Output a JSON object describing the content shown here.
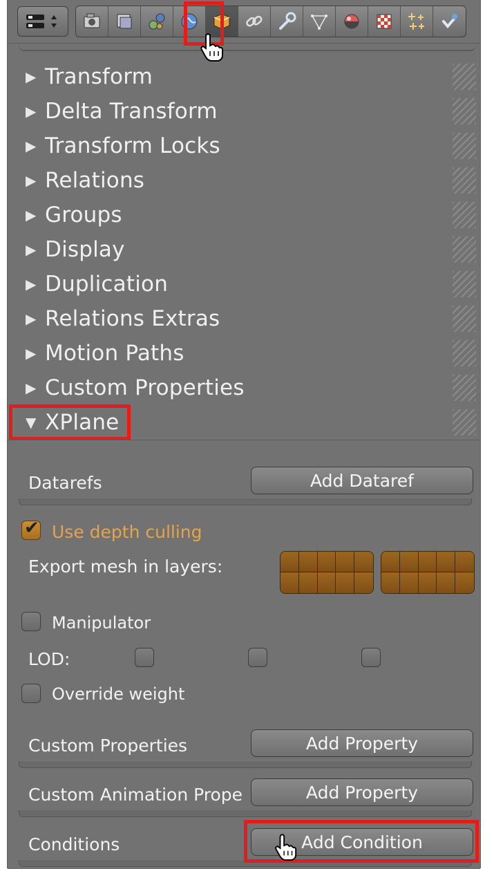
{
  "toolbar": {
    "context_icon": "editor-type-menu-icon",
    "tabs": [
      {
        "icon": "render-icon",
        "active": false
      },
      {
        "icon": "render-layers-icon",
        "active": false
      },
      {
        "icon": "scene-icon",
        "active": false
      },
      {
        "icon": "world-icon",
        "active": false
      },
      {
        "icon": "object-icon",
        "active": true
      },
      {
        "icon": "constraints-icon",
        "active": false
      },
      {
        "icon": "modifiers-icon",
        "active": false
      },
      {
        "icon": "object-data-icon",
        "active": false
      },
      {
        "icon": "material-icon",
        "active": false
      },
      {
        "icon": "texture-icon",
        "active": false
      },
      {
        "icon": "particles-icon",
        "active": false
      },
      {
        "icon": "physics-icon",
        "active": false
      }
    ]
  },
  "panels": [
    {
      "label": "Transform",
      "expanded": false
    },
    {
      "label": "Delta Transform",
      "expanded": false
    },
    {
      "label": "Transform Locks",
      "expanded": false
    },
    {
      "label": "Relations",
      "expanded": false
    },
    {
      "label": "Groups",
      "expanded": false
    },
    {
      "label": "Display",
      "expanded": false
    },
    {
      "label": "Duplication",
      "expanded": false
    },
    {
      "label": "Relations Extras",
      "expanded": false
    },
    {
      "label": "Motion Paths",
      "expanded": false
    },
    {
      "label": "Custom Properties",
      "expanded": false
    },
    {
      "label": "XPlane",
      "expanded": true
    }
  ],
  "xplane": {
    "datarefs_label": "Datarefs",
    "add_dataref_button": "Add Dataref",
    "use_depth_culling": {
      "label": "Use depth culling",
      "checked": true
    },
    "export_mesh_label": "Export mesh in layers:",
    "manipulator": {
      "label": "Manipulator",
      "checked": false
    },
    "lod_label": "LOD:",
    "lod_checkboxes": [
      false,
      false,
      false
    ],
    "override_weight": {
      "label": "Override weight",
      "checked": false
    },
    "custom_properties_label": "Custom Properties",
    "add_property_button": "Add Property",
    "custom_animation_label": "Custom Animation Prope",
    "add_property_button_2": "Add Property",
    "conditions_label": "Conditions",
    "add_condition_button": "Add Condition"
  },
  "colors": {
    "panel_bg": "#727272",
    "highlight_red": "#e51c1c",
    "accent_orange": "#e4a34c",
    "layer_fill": "#9b661f"
  }
}
